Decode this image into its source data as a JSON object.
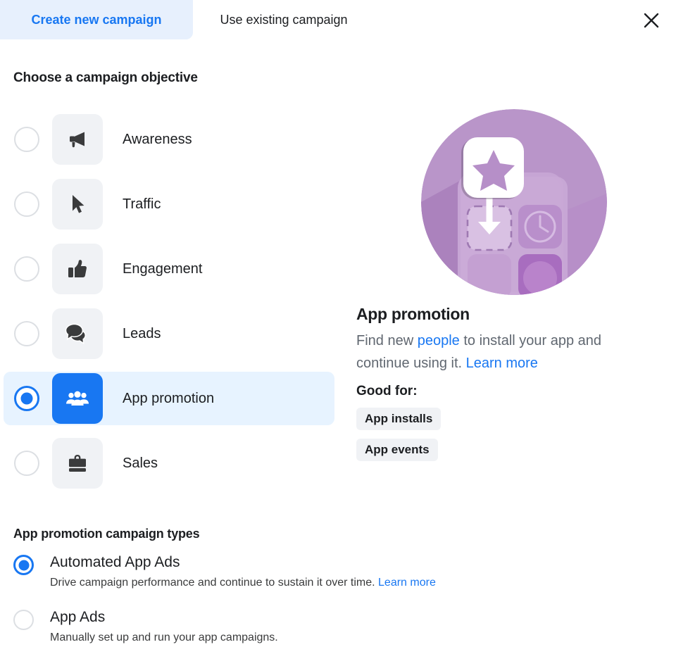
{
  "tabs": [
    {
      "label": "Create new campaign",
      "active": true
    },
    {
      "label": "Use existing campaign",
      "active": false
    }
  ],
  "close_label": "close-icon",
  "objective_section": {
    "title": "Choose a campaign objective",
    "items": [
      {
        "label": "Awareness",
        "icon": "megaphone-icon",
        "selected": false
      },
      {
        "label": "Traffic",
        "icon": "cursor-arrow-icon",
        "selected": false
      },
      {
        "label": "Engagement",
        "icon": "thumbs-up-icon",
        "selected": false
      },
      {
        "label": "Leads",
        "icon": "speech-bubbles-icon",
        "selected": false
      },
      {
        "label": "App promotion",
        "icon": "people-group-icon",
        "selected": true
      },
      {
        "label": "Sales",
        "icon": "briefcase-icon",
        "selected": false
      }
    ]
  },
  "detail": {
    "illustration": "app-install-illustration",
    "title": "App promotion",
    "desc_part1": "Find new ",
    "desc_link1": "people",
    "desc_part2": " to install your app and continue using it. ",
    "desc_link2": "Learn more",
    "good_for_label": "Good for:",
    "chips": [
      "App installs",
      "App events"
    ]
  },
  "types_section": {
    "title": "App promotion campaign types",
    "items": [
      {
        "label": "Automated App Ads",
        "desc": "Drive campaign performance and continue to sustain it over time. ",
        "link": "Learn more",
        "selected": true
      },
      {
        "label": "App Ads",
        "desc": "Manually set up and run your app campaigns.",
        "link": "",
        "selected": false
      }
    ]
  },
  "colors": {
    "accent": "#1877f2",
    "tab_active_bg": "#e7f0fd",
    "row_selected_bg": "#e7f3ff",
    "tile_bg": "#f0f2f5",
    "text_primary": "#1c1e21",
    "text_secondary": "#606770",
    "illustration_purple": "#b08ec0"
  }
}
